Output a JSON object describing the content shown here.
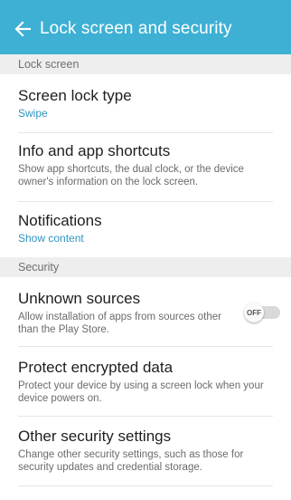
{
  "appbar": {
    "back_icon": "arrow-left-icon",
    "title": "Lock screen and security",
    "bg_color": "#3db0d4"
  },
  "sections": [
    {
      "header": "Lock screen",
      "items": [
        {
          "title": "Screen lock type",
          "value": "Swipe"
        },
        {
          "title": "Info and app shortcuts",
          "description": "Show app shortcuts, the dual clock, or the device owner's information on the lock screen."
        },
        {
          "title": "Notifications",
          "value": "Show content"
        }
      ]
    },
    {
      "header": "Security",
      "items": [
        {
          "title": "Unknown sources",
          "description": "Allow installation of apps from sources other than the Play Store.",
          "toggle": {
            "label": "OFF",
            "checked": false
          }
        },
        {
          "title": "Protect encrypted data",
          "description": "Protect your device by using a screen lock when your device powers on."
        },
        {
          "title": "Other security settings",
          "description": "Change other security settings, such as those for security updates and credential storage."
        }
      ]
    }
  ],
  "colors": {
    "accent_value": "#2e95c0",
    "section_bg": "#eeeeee"
  }
}
